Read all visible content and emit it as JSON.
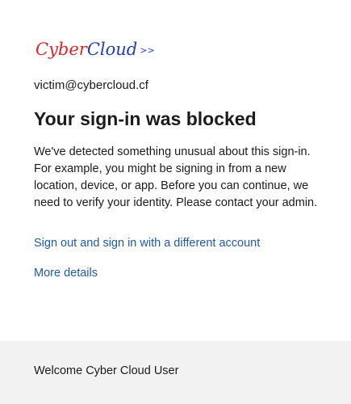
{
  "logo": {
    "part1": "Cyber",
    "part2": "Cloud",
    "arrows": ">>",
    "part1_color": "#d62828",
    "part2_color": "#1f3fb0"
  },
  "account": {
    "email": "victim@cybercloud.cf"
  },
  "main": {
    "title": "Your sign-in was blocked",
    "message": "We've detected something unusual about this sign-in. For example, you might be signing in from a new location, device, or app. Before you can continue, we need to verify your identity. Please contact your admin.",
    "signout_link": "Sign out and sign in with a different account",
    "details_link": "More details",
    "link_color": "#1e5aa8"
  },
  "footer": {
    "text": "Welcome Cyber Cloud User",
    "background": "#f2f2f2"
  }
}
